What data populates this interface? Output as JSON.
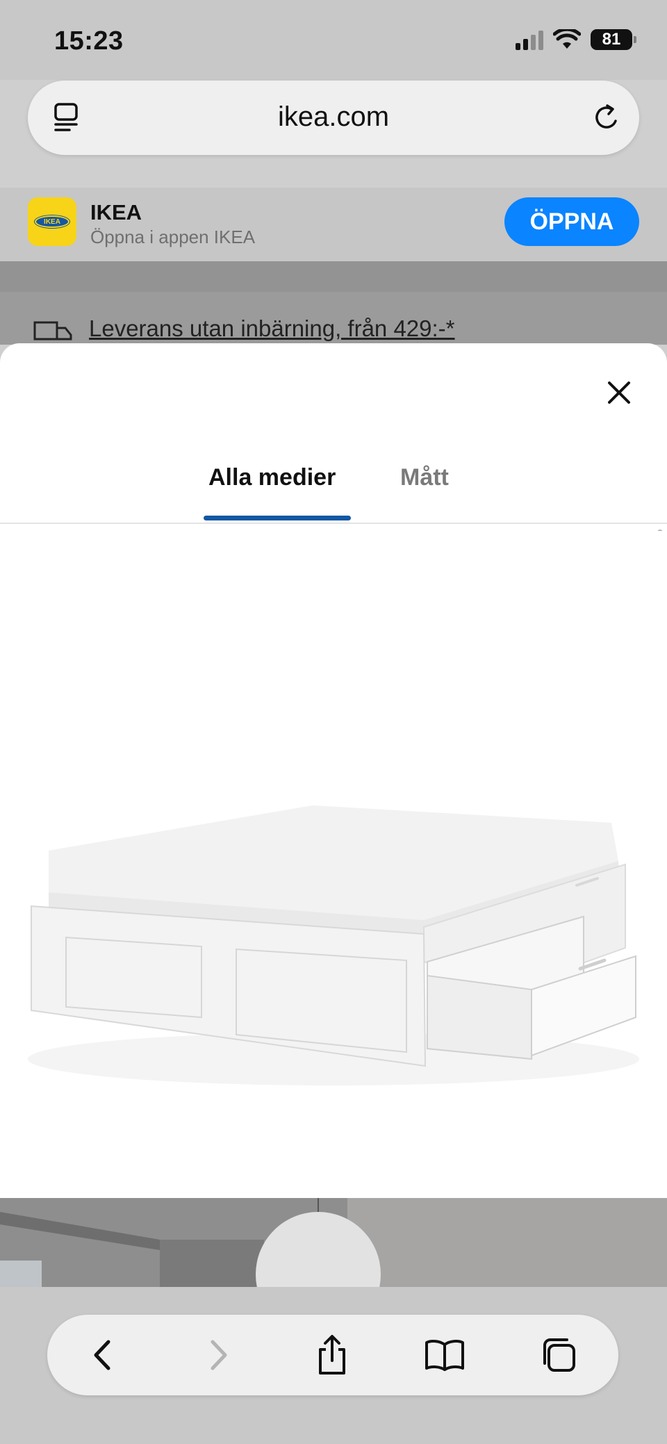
{
  "status_bar": {
    "time": "15:23",
    "battery": "81"
  },
  "browser": {
    "url": "ikea.com"
  },
  "app_banner": {
    "name": "IKEA",
    "subtitle": "Öppna i appen IKEA",
    "open_label": "ÖPPNA",
    "logo_text": "IKEA",
    "logo_colors": {
      "background": "#f7d417",
      "oval": "#1557a3"
    },
    "button_color": "#0a84ff"
  },
  "page": {
    "delivery_text": "Leverans utan inbärning, från 429:-*"
  },
  "media_sheet": {
    "tabs": [
      {
        "label": "Alla medier",
        "active": true
      },
      {
        "label": "Mått",
        "active": false
      }
    ],
    "accent_color": "#1157a3",
    "images": [
      {
        "alt_icon": "bed-frame-with-drawers-image"
      },
      {
        "alt_icon": "bedroom-room-image"
      }
    ]
  },
  "icons": {
    "tabs_menu": "tab-overview-icon",
    "reload": "reload-icon",
    "close": "close-icon",
    "back": "chevron-left-icon",
    "forward": "chevron-right-icon",
    "share": "share-icon",
    "bookmarks": "book-icon",
    "tabs": "tabs-icon"
  }
}
